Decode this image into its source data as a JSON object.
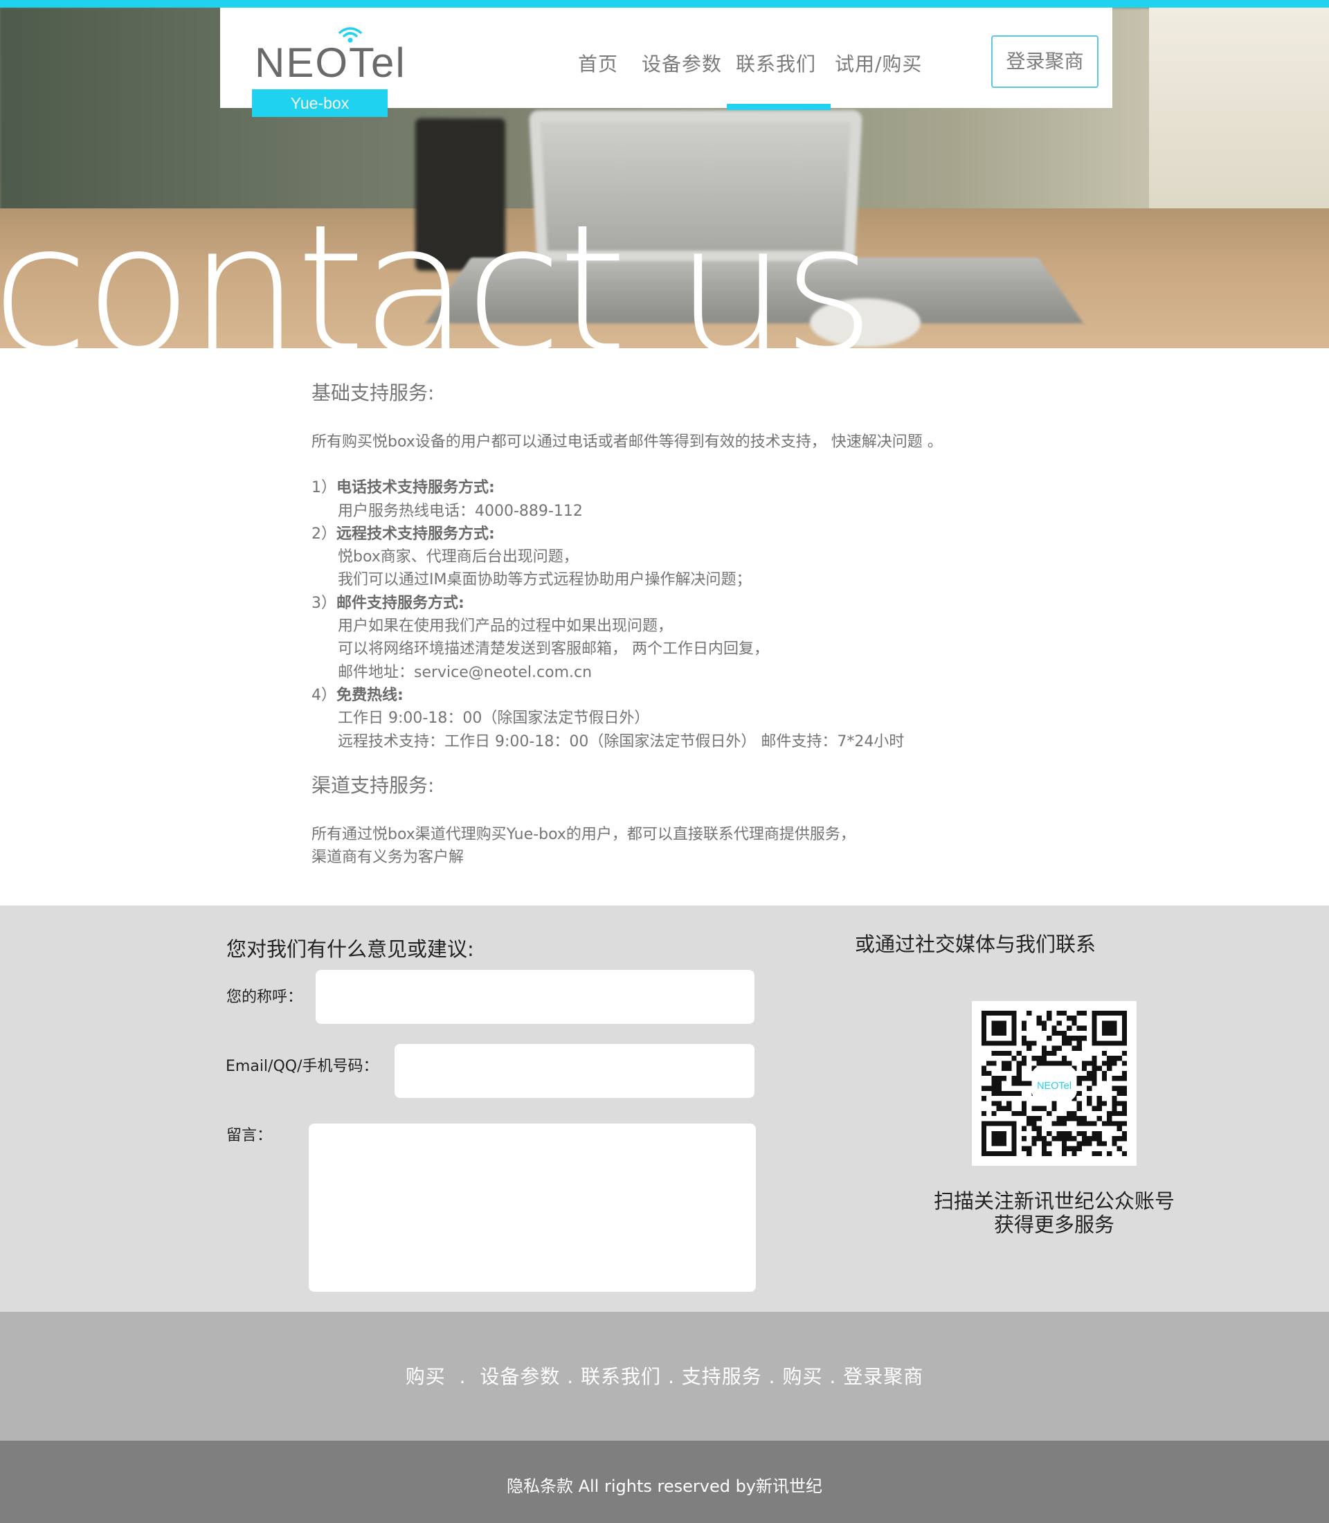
{
  "colors": {
    "accent": "#1ed2f0",
    "feedback_bg": "#dcdcdc",
    "footer_nav_bg": "#b4b4b4",
    "footer_copy_bg": "#7f7f7f"
  },
  "brand": {
    "logo_text": "NEOTel",
    "tagline": "Yue-box",
    "logo_icon": "wifi-icon"
  },
  "nav": {
    "items": [
      {
        "label": "首页"
      },
      {
        "label": "设备参数"
      },
      {
        "label": "联系我们"
      },
      {
        "label": "试用/购买"
      }
    ],
    "active_label": "联系我们",
    "login_label": "登录聚商"
  },
  "hero": {
    "title": "contact us"
  },
  "content": {
    "basic_heading": "基础支持服务:",
    "basic_intro": "所有购买悦box设备的用户都可以通过电话或者邮件等得到有效的技术支持， 快速解决问题 。",
    "items": [
      {
        "num": "1）",
        "title": "电话技术支持服务方式:",
        "lines": [
          "用户服务热线电话：4000-889-112"
        ]
      },
      {
        "num": "2）",
        "title": "远程技术支持服务方式:",
        "lines": [
          "悦box商家、代理商后台出现问题，",
          "我们可以通过IM桌面协助等方式远程协助用户操作解决问题；"
        ]
      },
      {
        "num": "3）",
        "title": "邮件支持服务方式:",
        "lines": [
          "用户如果在使用我们产品的过程中如果出现问题，",
          "可以将网络环境描述清楚发送到客服邮箱， 两个工作日内回复，",
          "邮件地址：service@neotel.com.cn"
        ]
      },
      {
        "num": "4）",
        "title": "免费热线:",
        "lines": [
          "工作日 9:00-18：00（除国家法定节假日外）",
          "远程技术支持：工作日 9:00-18：00（除国家法定节假日外） 邮件支持：7*24小时"
        ]
      }
    ],
    "channel_heading": "渠道支持服务:",
    "channel_lines": [
      "所有通过悦box渠道代理购买Yue-box的用户，都可以直接联系代理商提供服务，",
      "渠道商有义务为客户解"
    ]
  },
  "feedback": {
    "title": "您对我们有什么意见或建议:",
    "name_label": "您的称呼：",
    "contact_label": "Email/QQ/手机号码：",
    "message_label": "留言：",
    "name_value": "",
    "contact_value": "",
    "message_value": ""
  },
  "social": {
    "title": "或通过社交媒体与我们联系",
    "qr_icon": "qr-code",
    "caption_line1": "扫描关注新讯世纪公众账号",
    "caption_line2": "获得更多服务"
  },
  "footer": {
    "links": [
      "购买",
      "设备参数",
      "联系我们",
      "支持服务",
      "购买",
      "登录聚商"
    ],
    "copyright": "隐私条款 All rights reserved by新讯世纪"
  }
}
